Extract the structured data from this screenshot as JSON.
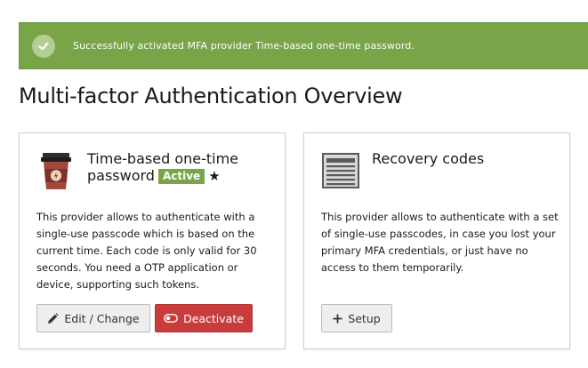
{
  "flash": {
    "message": "Successfully activated MFA provider Time-based one-time password.",
    "icon": "check-circle-icon",
    "color": "#79a548"
  },
  "page": {
    "title": "Multi-factor Authentication Overview"
  },
  "providers": [
    {
      "icon": "coffee-cup-icon",
      "title_line1": "Time-based one-time",
      "title_line2": "password",
      "badge": "Active",
      "badge_color": "#79a548",
      "star": "★",
      "description": "This provider allows to authenticate with a single-use passcode which is based on the current time. Each code is only valid for 30 seconds. You need a OTP application or device, supporting such tokens.",
      "edit_label": "Edit / Change",
      "deactivate_label": "Deactivate",
      "deactivate_color": "#c83c3c"
    },
    {
      "icon": "recovery-codes-icon",
      "title_line1": "Recovery codes",
      "description": "This provider allows to authenticate with a set of single-use passcodes, in case you lost your primary MFA credentials, or just have no access to them temporarily.",
      "setup_label": "Setup"
    }
  ]
}
